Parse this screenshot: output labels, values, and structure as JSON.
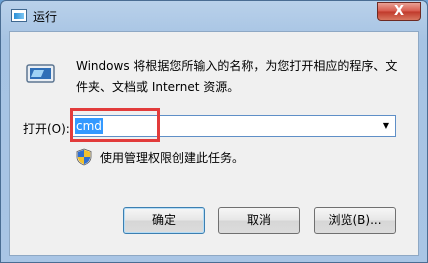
{
  "window": {
    "title": "运行",
    "close_symbol": "X"
  },
  "dialog": {
    "description": "Windows 将根据您所输入的名称，为您打开相应的程序、文件夹、文档或 Internet 资源。",
    "open_label": "打开(O):",
    "command_value": "cmd",
    "admin_note": "使用管理权限创建此任务。"
  },
  "buttons": {
    "ok": "确定",
    "cancel": "取消",
    "browse": "浏览(B)..."
  },
  "icons": {
    "title": "run-dialog-icon",
    "run": "run-program-icon",
    "shield": "uac-shield-icon",
    "dropdown": "chevron-down-icon"
  },
  "colors": {
    "highlight_box": "#e23b3b",
    "selection": "#3399ff"
  }
}
